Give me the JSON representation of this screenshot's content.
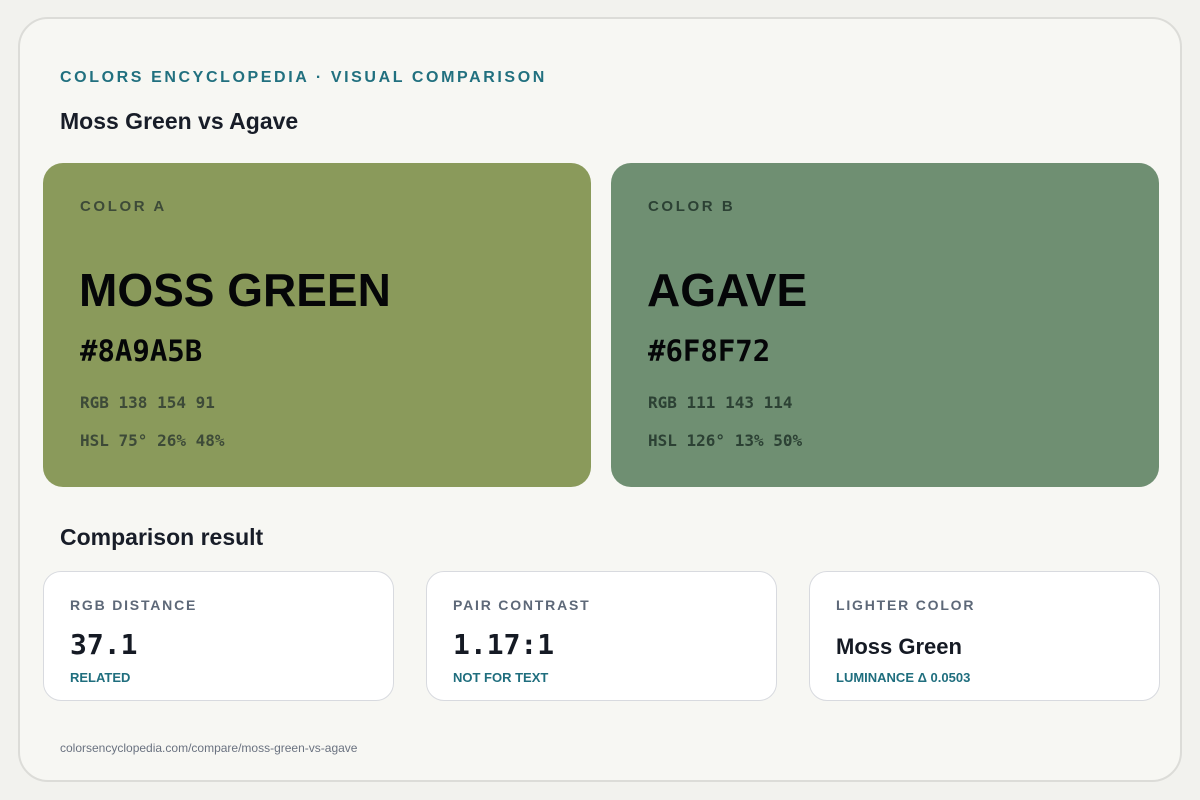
{
  "header": {
    "kicker": "COLORS ENCYCLOPEDIA · VISUAL COMPARISON",
    "title": "Moss Green vs Agave"
  },
  "colors": [
    {
      "label": "COLOR A",
      "name": "MOSS GREEN",
      "hex": "#8A9A5B",
      "rgb": "RGB 138 154 91",
      "hsl": "HSL 75° 26% 48%",
      "swatch_color": "#8A9A5B",
      "muted_text_color": "#3d4a38"
    },
    {
      "label": "COLOR B",
      "name": "AGAVE",
      "hex": "#6F8F72",
      "rgb": "RGB 111 143 114",
      "hsl": "HSL 126° 13% 50%",
      "swatch_color": "#6F8F72",
      "muted_text_color": "#2c4134"
    }
  ],
  "comparison": {
    "title": "Comparison result",
    "cards": [
      {
        "label": "RGB DISTANCE",
        "value": "37.1",
        "note": "RELATED"
      },
      {
        "label": "PAIR CONTRAST",
        "value": "1.17:1",
        "note": "NOT FOR TEXT"
      },
      {
        "label": "LIGHTER COLOR",
        "value": "Moss Green",
        "note": "LUMINANCE Δ 0.0503"
      }
    ]
  },
  "footer": {
    "url": "colorsencyclopedia.com/compare/moss-green-vs-agave"
  },
  "theme": {
    "accent": "#21707F",
    "page_background": "#F7F7F3"
  }
}
